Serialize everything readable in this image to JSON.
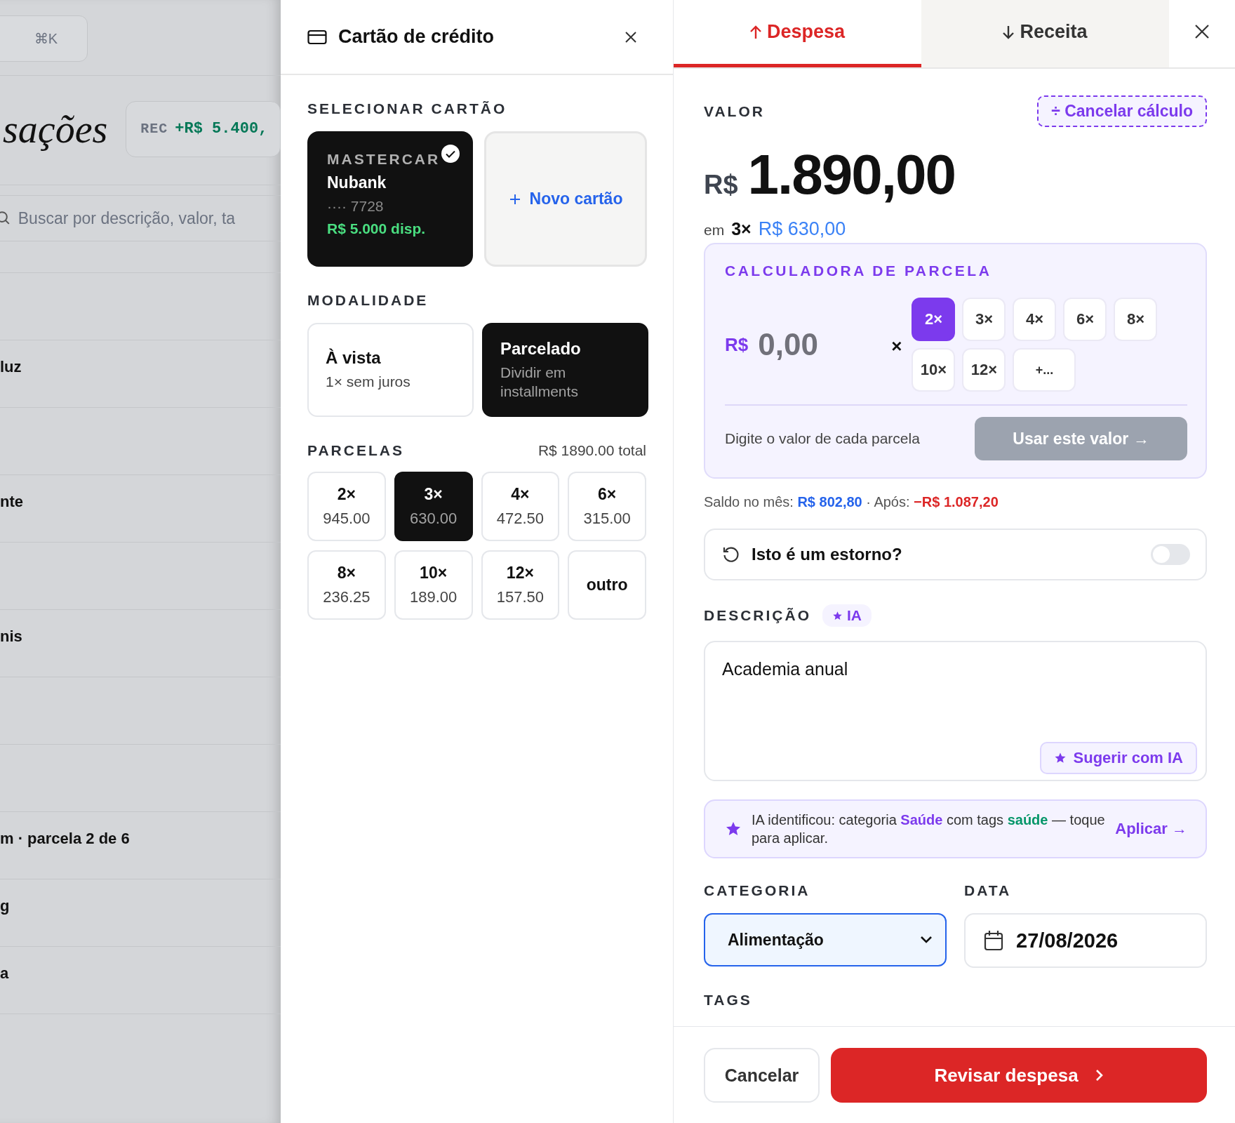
{
  "background": {
    "shortcut": "⌘K",
    "title": "sações",
    "summary": {
      "label": "REC",
      "value": "+R$ 5.400,"
    },
    "search": {
      "placeholder": "Buscar por descrição, valor, ta"
    },
    "rows": [
      {},
      {
        "title": "luz"
      },
      {},
      {
        "title": "nte"
      },
      {},
      {
        "title": "nis"
      },
      {},
      {},
      {
        "title": "m · parcela 2 de 6"
      },
      {
        "title": "g"
      },
      {
        "title": "a"
      }
    ]
  },
  "card_panel": {
    "title": "Cartão de crédito",
    "select_card": {
      "label": "SELECIONAR CARTÃO",
      "cards": [
        {
          "kind": "card",
          "brand": "MASTERCAR",
          "name": "Nubank",
          "number": "···· 7728",
          "available": "R$ 5.000 disp.",
          "selected": true
        },
        {
          "kind": "add",
          "label": "Novo cartão",
          "selected": false
        }
      ]
    },
    "mode": {
      "label": "MODALIDADE",
      "options": [
        {
          "title": "À vista",
          "subtitle": "1× sem juros",
          "selected": false
        },
        {
          "title": "Parcelado",
          "subtitle": "Dividir em installments",
          "selected": true
        }
      ]
    },
    "installments": {
      "label": "PARCELAS",
      "total": "R$ 1890.00 total",
      "options": [
        {
          "kind": "count",
          "count": "2×",
          "amount": "945.00",
          "selected": false
        },
        {
          "kind": "count",
          "count": "3×",
          "amount": "630.00",
          "selected": true
        },
        {
          "kind": "count",
          "count": "4×",
          "amount": "472.50",
          "selected": false
        },
        {
          "kind": "count",
          "count": "6×",
          "amount": "315.00",
          "selected": false
        },
        {
          "kind": "count",
          "count": "8×",
          "amount": "236.25",
          "selected": false
        },
        {
          "kind": "count",
          "count": "10×",
          "amount": "189.00",
          "selected": false
        },
        {
          "kind": "count",
          "count": "12×",
          "amount": "157.50",
          "selected": false
        },
        {
          "kind": "other",
          "count": "outro",
          "selected": false
        }
      ]
    }
  },
  "transaction_panel": {
    "tabs": [
      {
        "kind": "expense",
        "label": "Despesa",
        "selected": true
      },
      {
        "kind": "income",
        "label": "Receita",
        "selected": false
      }
    ],
    "value": {
      "label": "VALOR",
      "cancel_button": "÷ Cancelar cálculo",
      "currency": "R$",
      "amount": "1.890,00",
      "split": {
        "prefix": "em",
        "count": "3×",
        "amount": "R$ 630,00"
      }
    },
    "calculator": {
      "title": "CALCULADORA DE PARCELA",
      "currency": "R$",
      "placeholder": "0,00",
      "times": "×",
      "options": [
        {
          "label": "2×",
          "selected": true
        },
        {
          "label": "3×",
          "selected": false
        },
        {
          "label": "4×",
          "selected": false
        },
        {
          "label": "6×",
          "selected": false
        },
        {
          "label": "8×",
          "selected": false
        },
        {
          "label": "10×",
          "selected": false
        },
        {
          "label": "12×",
          "selected": false
        },
        {
          "label": "+...",
          "selected": false
        }
      ],
      "hint": "Digite o valor de cada parcela",
      "apply_button": "Usar este valor →",
      "apply_disabled": true
    },
    "balance": [
      {
        "kind": "plain",
        "text": "Saldo no mês: "
      },
      {
        "kind": "positive",
        "text": "R$ 802,80"
      },
      {
        "kind": "plain",
        "text": " · Após: "
      },
      {
        "kind": "negative",
        "text": "−R$ 1.087,20"
      }
    ],
    "reversal": {
      "label": "Isto é um estorno?",
      "on": false
    },
    "description": {
      "label": "DESCRIÇÃO",
      "badge": "IA",
      "value": "Academia anual",
      "suggest_button": "Sugerir com IA"
    },
    "ai_suggestion": {
      "parts": [
        {
          "kind": "plain",
          "text": "IA identificou: categoria "
        },
        {
          "kind": "category",
          "text": "Saúde"
        },
        {
          "kind": "plain",
          "text": " com tags "
        },
        {
          "kind": "tag",
          "text": "saúde"
        },
        {
          "kind": "plain",
          "text": " — toque para aplicar."
        }
      ],
      "action": "Aplicar →"
    },
    "category": {
      "label": "CATEGORIA",
      "value": "Alimentação"
    },
    "date": {
      "label": "DATA",
      "value": "27/08/2026"
    },
    "tags": {
      "label": "TAGS"
    },
    "footer": {
      "cancel": "Cancelar",
      "submit": "Revisar despesa"
    }
  }
}
